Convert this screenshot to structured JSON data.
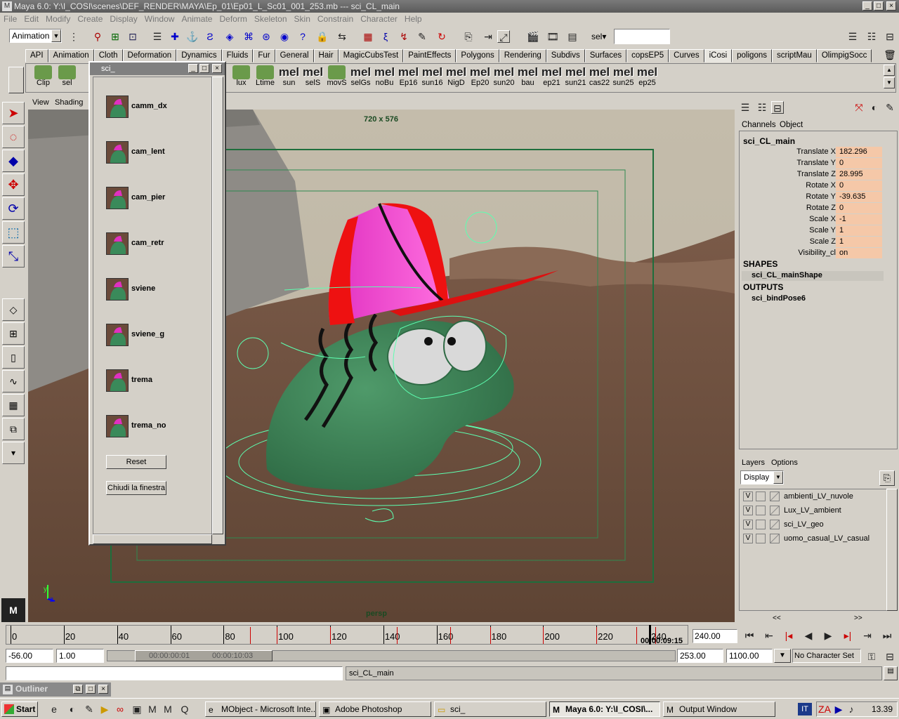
{
  "window": {
    "title": "Maya 6.0: Y:\\I_COSI\\scenes\\DEF_RENDER\\MAYA\\Ep_01\\Ep01_L_Sc01_001_253.mb  ---  sci_CL_main"
  },
  "menubar": [
    "File",
    "Edit",
    "Modify",
    "Create",
    "Display",
    "Window",
    "Animate",
    "Deform",
    "Skeleton",
    "Skin",
    "Constrain",
    "Character",
    "Help"
  ],
  "status": {
    "menuset": "Animation",
    "sel_label": "sel▾",
    "sel_value": ""
  },
  "shelf_tabs": [
    "API",
    "Animation",
    "Cloth",
    "Deformation",
    "Dynamics",
    "Fluids",
    "Fur",
    "General",
    "Hair",
    "MagicCubsTest",
    "PaintEffects",
    "Polygons",
    "Rendering",
    "Subdivs",
    "Surfaces",
    "copsEP5",
    "Curves",
    "iCosi",
    "poligons",
    "scriptMau",
    "OlimpigSocc"
  ],
  "shelf_active": "iCosi",
  "shelf_buttons": [
    {
      "top": "",
      "bottom": "Clip"
    },
    {
      "top": "",
      "bottom": "sel"
    },
    {
      "top": "",
      "bottom": "lux"
    },
    {
      "top": "",
      "bottom": "Ltime"
    },
    {
      "top": "mel",
      "bottom": "sun"
    },
    {
      "top": "mel",
      "bottom": "selS"
    },
    {
      "top": "",
      "bottom": "movS"
    },
    {
      "top": "mel",
      "bottom": "selGs"
    },
    {
      "top": "mel",
      "bottom": "noBu"
    },
    {
      "top": "mel",
      "bottom": "Ep16"
    },
    {
      "top": "mel",
      "bottom": "sun16"
    },
    {
      "top": "mel",
      "bottom": "NigD"
    },
    {
      "top": "mel",
      "bottom": "Ep20"
    },
    {
      "top": "mel",
      "bottom": "sun20"
    },
    {
      "top": "mel",
      "bottom": "bau"
    },
    {
      "top": "mel",
      "bottom": "ep21"
    },
    {
      "top": "mel",
      "bottom": "sun21"
    },
    {
      "top": "mel",
      "bottom": "cas22"
    },
    {
      "top": "mel",
      "bottom": "sun25"
    },
    {
      "top": "mel",
      "bottom": "ep25"
    }
  ],
  "panel": {
    "menus": [
      "View",
      "Shading"
    ],
    "resolution": "720 x 576",
    "camera": "persp"
  },
  "sci_window": {
    "title": "sci_",
    "items": [
      "camm_dx",
      "cam_lent",
      "cam_pier",
      "cam_retr",
      "sviene",
      "sviene_g",
      "trema",
      "trema_no"
    ],
    "reset_label": "Reset",
    "close_label": "Chiudi la finestra"
  },
  "channel_box": {
    "tabs": [
      "Channels",
      "Object"
    ],
    "object": "sci_CL_main",
    "channels": [
      {
        "name": "Translate X",
        "value": "182.296"
      },
      {
        "name": "Translate Y",
        "value": "0"
      },
      {
        "name": "Translate Z",
        "value": "28.995"
      },
      {
        "name": "Rotate X",
        "value": "0"
      },
      {
        "name": "Rotate Y",
        "value": "-39.635"
      },
      {
        "name": "Rotate Z",
        "value": "0"
      },
      {
        "name": "Scale X",
        "value": "-1"
      },
      {
        "name": "Scale Y",
        "value": "1"
      },
      {
        "name": "Scale Z",
        "value": "1"
      },
      {
        "name": "Visibility_cl",
        "value": "on"
      }
    ],
    "shapes_header": "SHAPES",
    "shape": "sci_CL_mainShape",
    "outputs_header": "OUTPUTS",
    "output": "sci_bindPose6"
  },
  "layers": {
    "menus": [
      "Layers",
      "Options"
    ],
    "mode": "Display",
    "items": [
      {
        "v": "V",
        "name": "ambienti_LV_nuvole"
      },
      {
        "v": "V",
        "name": "Lux_LV_ambient"
      },
      {
        "v": "V",
        "name": "sci_LV_geo"
      },
      {
        "v": "V",
        "name": "uomo_casual_LV_casual"
      }
    ],
    "nav_left": "<<",
    "nav_right": ">>"
  },
  "timeline": {
    "ticks": [
      "0",
      "20",
      "40",
      "60",
      "80",
      "100",
      "120",
      "140",
      "160",
      "180",
      "200",
      "220",
      "240"
    ],
    "current_frame": "240",
    "timecode": "00:00:09:15",
    "current_field": "240.00"
  },
  "range": {
    "start": "-56.00",
    "playback_start": "1.00",
    "range_start_tc": "00:00:00:01",
    "range_end_tc": "00:00:10:03",
    "playback_end": "253.00",
    "end": "1100.00",
    "character_set": "No Character Set"
  },
  "command_line": {
    "input": "",
    "result": "sci_CL_main"
  },
  "outliner": {
    "title": "Outliner"
  },
  "taskbar": {
    "start": "Start",
    "tasks": [
      "MObject - Microsoft Inte...",
      "Adobe Photoshop",
      "sci_",
      "Maya 6.0: Y:\\I_COSI\\...",
      "Output Window"
    ],
    "active_task": "Maya 6.0: Y:\\I_COSI\\...",
    "lang": "IT",
    "clock": "13.39"
  },
  "axis": {
    "x": "z",
    "y": "y"
  }
}
